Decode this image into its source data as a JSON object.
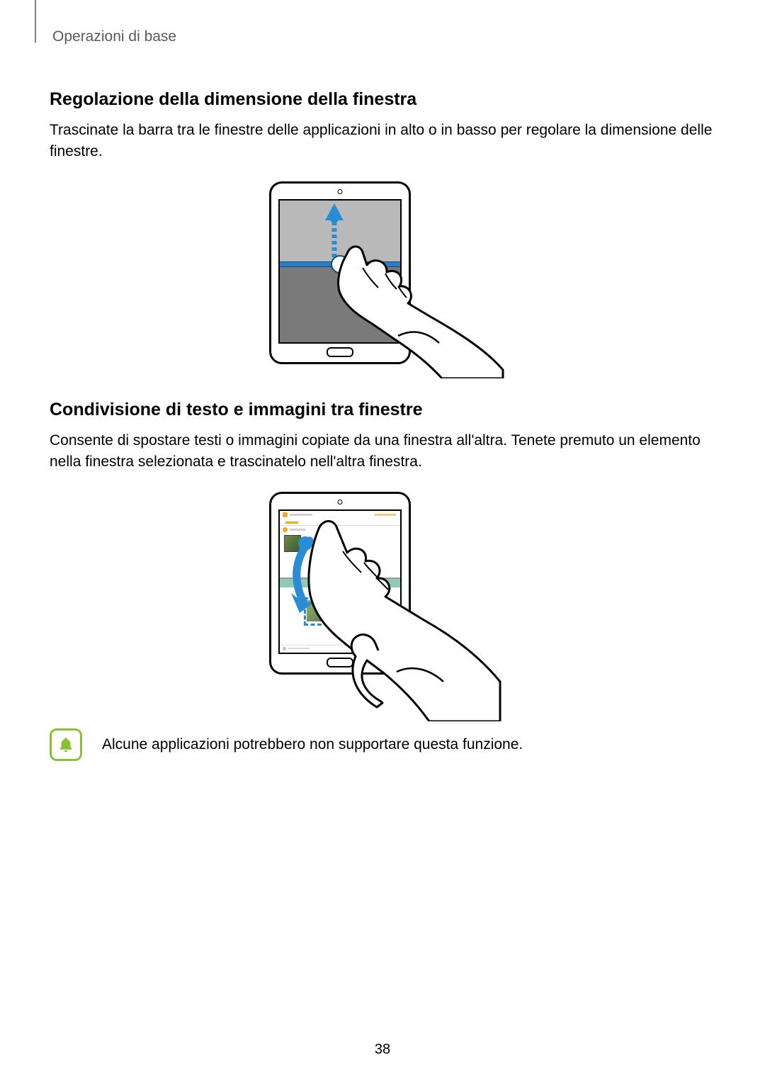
{
  "header": {
    "breadcrumb": "Operazioni di base"
  },
  "section1": {
    "title": "Regolazione della dimensione della finestra",
    "body": "Trascinate la barra tra le finestre delle applicazioni in alto o in basso per regolare la dimensione delle finestre."
  },
  "section2": {
    "title": "Condivisione di testo e immagini tra finestre",
    "body": "Consente di spostare testi o immagini copiate da una finestra all'altra. Tenete premuto un elemento nella finestra selezionata e trascinatelo nell'altra finestra."
  },
  "note": {
    "text": "Alcune applicazioni potrebbero non supportare questa funzione."
  },
  "page_number": "38",
  "colors": {
    "accent_blue": "#2a8cd6",
    "note_green": "#8ac135",
    "app_orange": "#f5a623",
    "app_teal": "#79c2a8"
  }
}
